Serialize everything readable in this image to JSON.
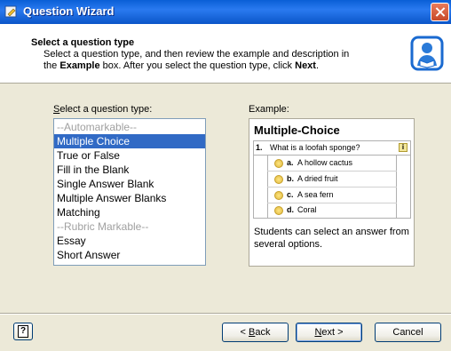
{
  "window": {
    "title": "Question Wizard"
  },
  "header": {
    "title": "Select a question type",
    "description_line1": "Select a question type, and then review the example and description in",
    "desc_the": "the ",
    "desc_example_bold": "Example",
    "desc_mid": " box. After you select the question type, click ",
    "desc_next_bold": "Next",
    "desc_end": "."
  },
  "list": {
    "label_accel": "S",
    "label_rest": "elect a question type:",
    "items": [
      {
        "label": "--Automarkable--",
        "state": "disabled"
      },
      {
        "label": "Multiple Choice",
        "state": "selected"
      },
      {
        "label": "True or False",
        "state": "normal"
      },
      {
        "label": "Fill in the Blank",
        "state": "normal"
      },
      {
        "label": "Single Answer Blank",
        "state": "normal"
      },
      {
        "label": "Multiple Answer Blanks",
        "state": "normal"
      },
      {
        "label": "Matching",
        "state": "normal"
      },
      {
        "label": "--Rubric Markable--",
        "state": "disabled"
      },
      {
        "label": "Essay",
        "state": "normal"
      },
      {
        "label": "Short Answer",
        "state": "normal"
      }
    ]
  },
  "example": {
    "label": "Example:",
    "title": "Multiple-Choice",
    "question_number": "1.",
    "question_text": "What is a loofah sponge?",
    "info_glyph": "i",
    "options": [
      {
        "letter": "a.",
        "text": "A hollow cactus"
      },
      {
        "letter": "b.",
        "text": "A dried fruit"
      },
      {
        "letter": "c.",
        "text": "A sea fern"
      },
      {
        "letter": "d.",
        "text": "Coral"
      }
    ],
    "description": "Students can select an answer from several options."
  },
  "footer": {
    "help_glyph": "?",
    "back_prefix": "< ",
    "back_accel": "B",
    "back_rest": "ack",
    "next_accel": "N",
    "next_rest": "ext >",
    "cancel_label": "Cancel"
  },
  "colors": {
    "selection": "#316ac5",
    "titlebar": "#0a5fd6",
    "dialog_bg": "#ece9d8"
  }
}
